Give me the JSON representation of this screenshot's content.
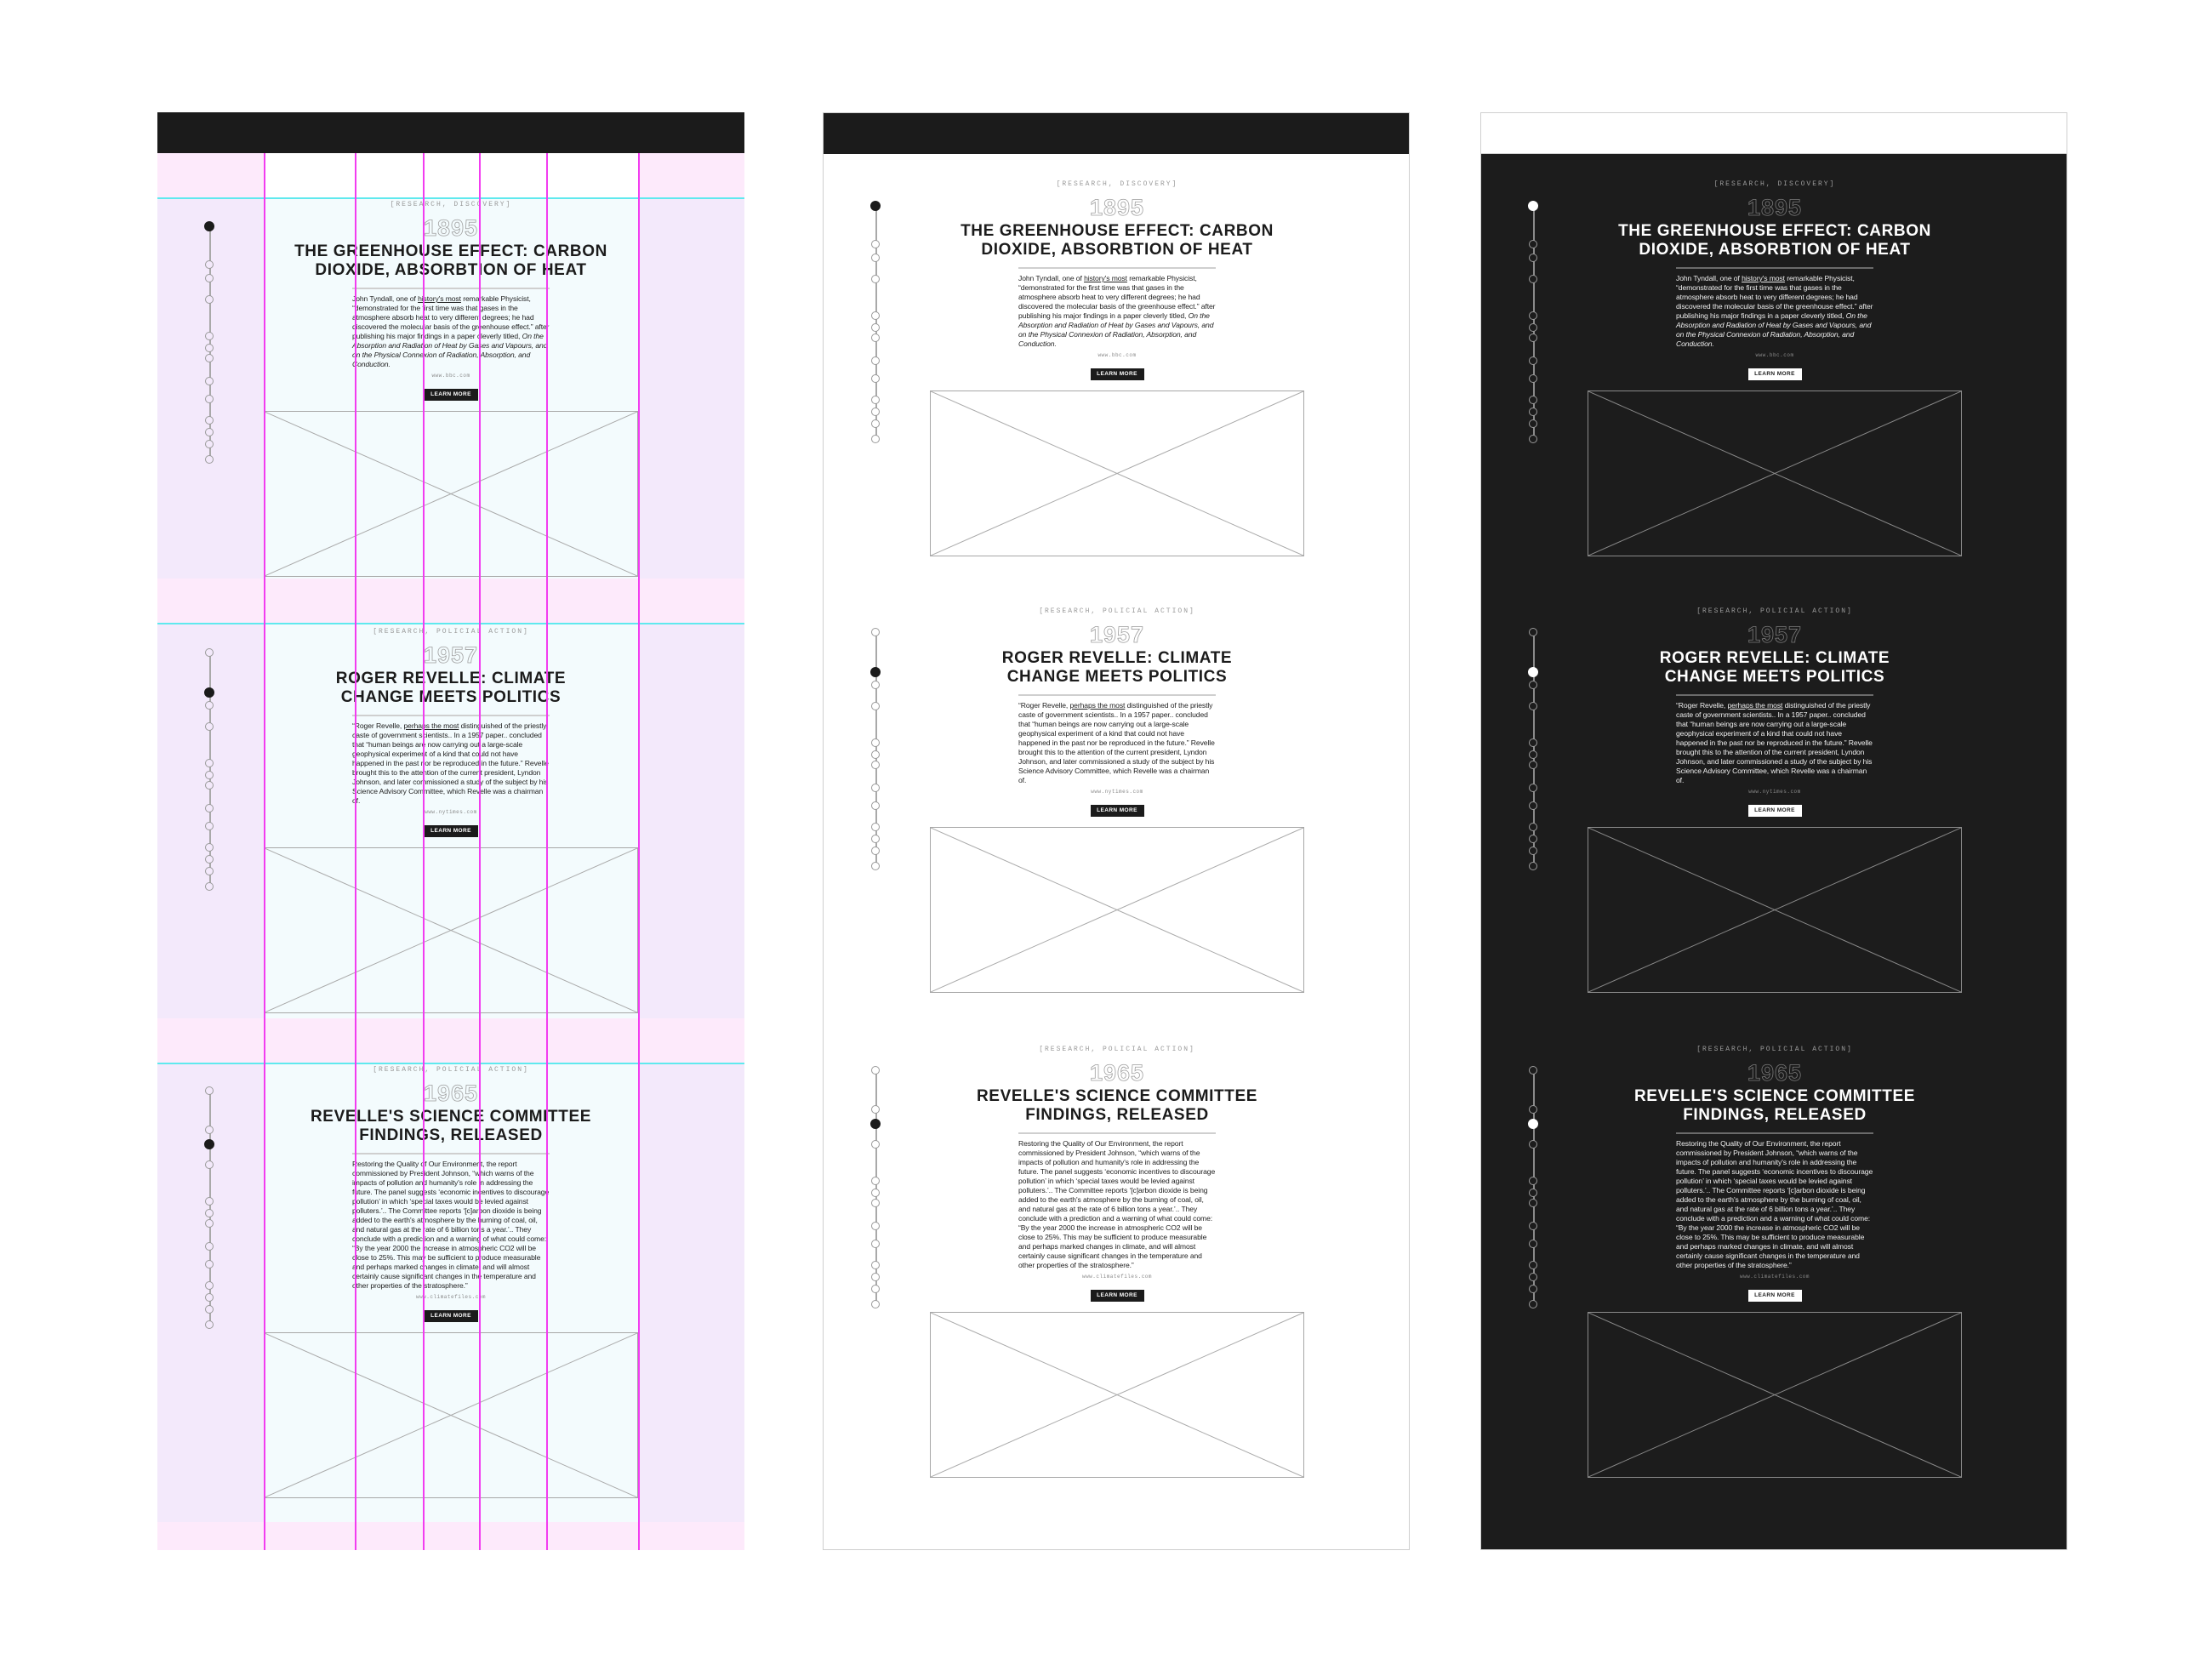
{
  "buttons": {
    "learn_more": "LEARN MORE"
  },
  "timeline": {
    "dot_count": 13,
    "active_index_per_entry": [
      0,
      1,
      2
    ]
  },
  "entries": [
    {
      "tags": "[RESEARCH, DISCOVERY]",
      "year": "1895",
      "title_lines": [
        "THE GREENHOUSE EFFECT: CARBON",
        "DIOXIDE, ABSORBTION OF HEAT"
      ],
      "body": [
        {
          "text": "John Tyndall, one of ",
          "style": ""
        },
        {
          "text": "history's most",
          "style": "u"
        },
        {
          "text": " remarkable Physicist, “demonstrated for the first time was that gases in the atmosphere absorb heat to very different degrees; he had discovered the molecular basis of the greenhouse effect.” after publishing his major findings in a paper cleverly titled, ",
          "style": ""
        },
        {
          "text": "On the Absorption and Radiation of Heat by Gases and Vapours, and on the Physical Connexion of Radiation, Absorption, and Conduction.",
          "style": "i"
        }
      ],
      "source": "www.bbc.com"
    },
    {
      "tags": "[RESEARCH, POLICIAL ACTION]",
      "year": "1957",
      "title_lines": [
        "ROGER REVELLE: CLIMATE",
        "CHANGE MEETS POLITICS"
      ],
      "body": [
        {
          "text": "“Roger Revelle, ",
          "style": ""
        },
        {
          "text": "perhaps the most",
          "style": "u"
        },
        {
          "text": " distinguished of the priestly caste of government scientists.. In a 1957 paper.. concluded that “human beings are now carrying out a large-scale geophysical experiment of a kind that could not have happened in the past nor be reproduced in the future.” Revelle brought this to the attention of the current president, Lyndon Johnson, and later commissioned a study of the subject by his Science Advisory Committee, which Revelle was a chairman of.",
          "style": ""
        }
      ],
      "source": "www.nytimes.com"
    },
    {
      "tags": "[RESEARCH, POLICIAL ACTION]",
      "year": "1965",
      "title_lines": [
        "REVELLE'S SCIENCE COMMITTEE",
        "FINDINGS, RELEASED"
      ],
      "body": [
        {
          "text": "Restoring the Quality of Our Environment, the report commissioned by President Johnson, “which warns of the impacts of pollution and humanity's role in addressing the future. The panel suggests ‘economic incentives to discourage pollution’ in which ‘special taxes would be levied against polluters.’.. The Committee reports ‘[c]arbon dioxide is being added to the earth's atmosphere by the burning of coal, oil, and natural gas at the rate of 6 billion tons a year.’.. They conclude with a prediction and a warning of what could come: “By the year 2000 the increase in atmospheric CO2 will be close to 25%. This may be sufficient to produce measurable and perhaps marked changes in climate, and will almost certainly cause significant changes in the temperature and other properties of the stratosphere.”",
          "style": ""
        }
      ],
      "source": "www.climatefiles.com"
    }
  ]
}
